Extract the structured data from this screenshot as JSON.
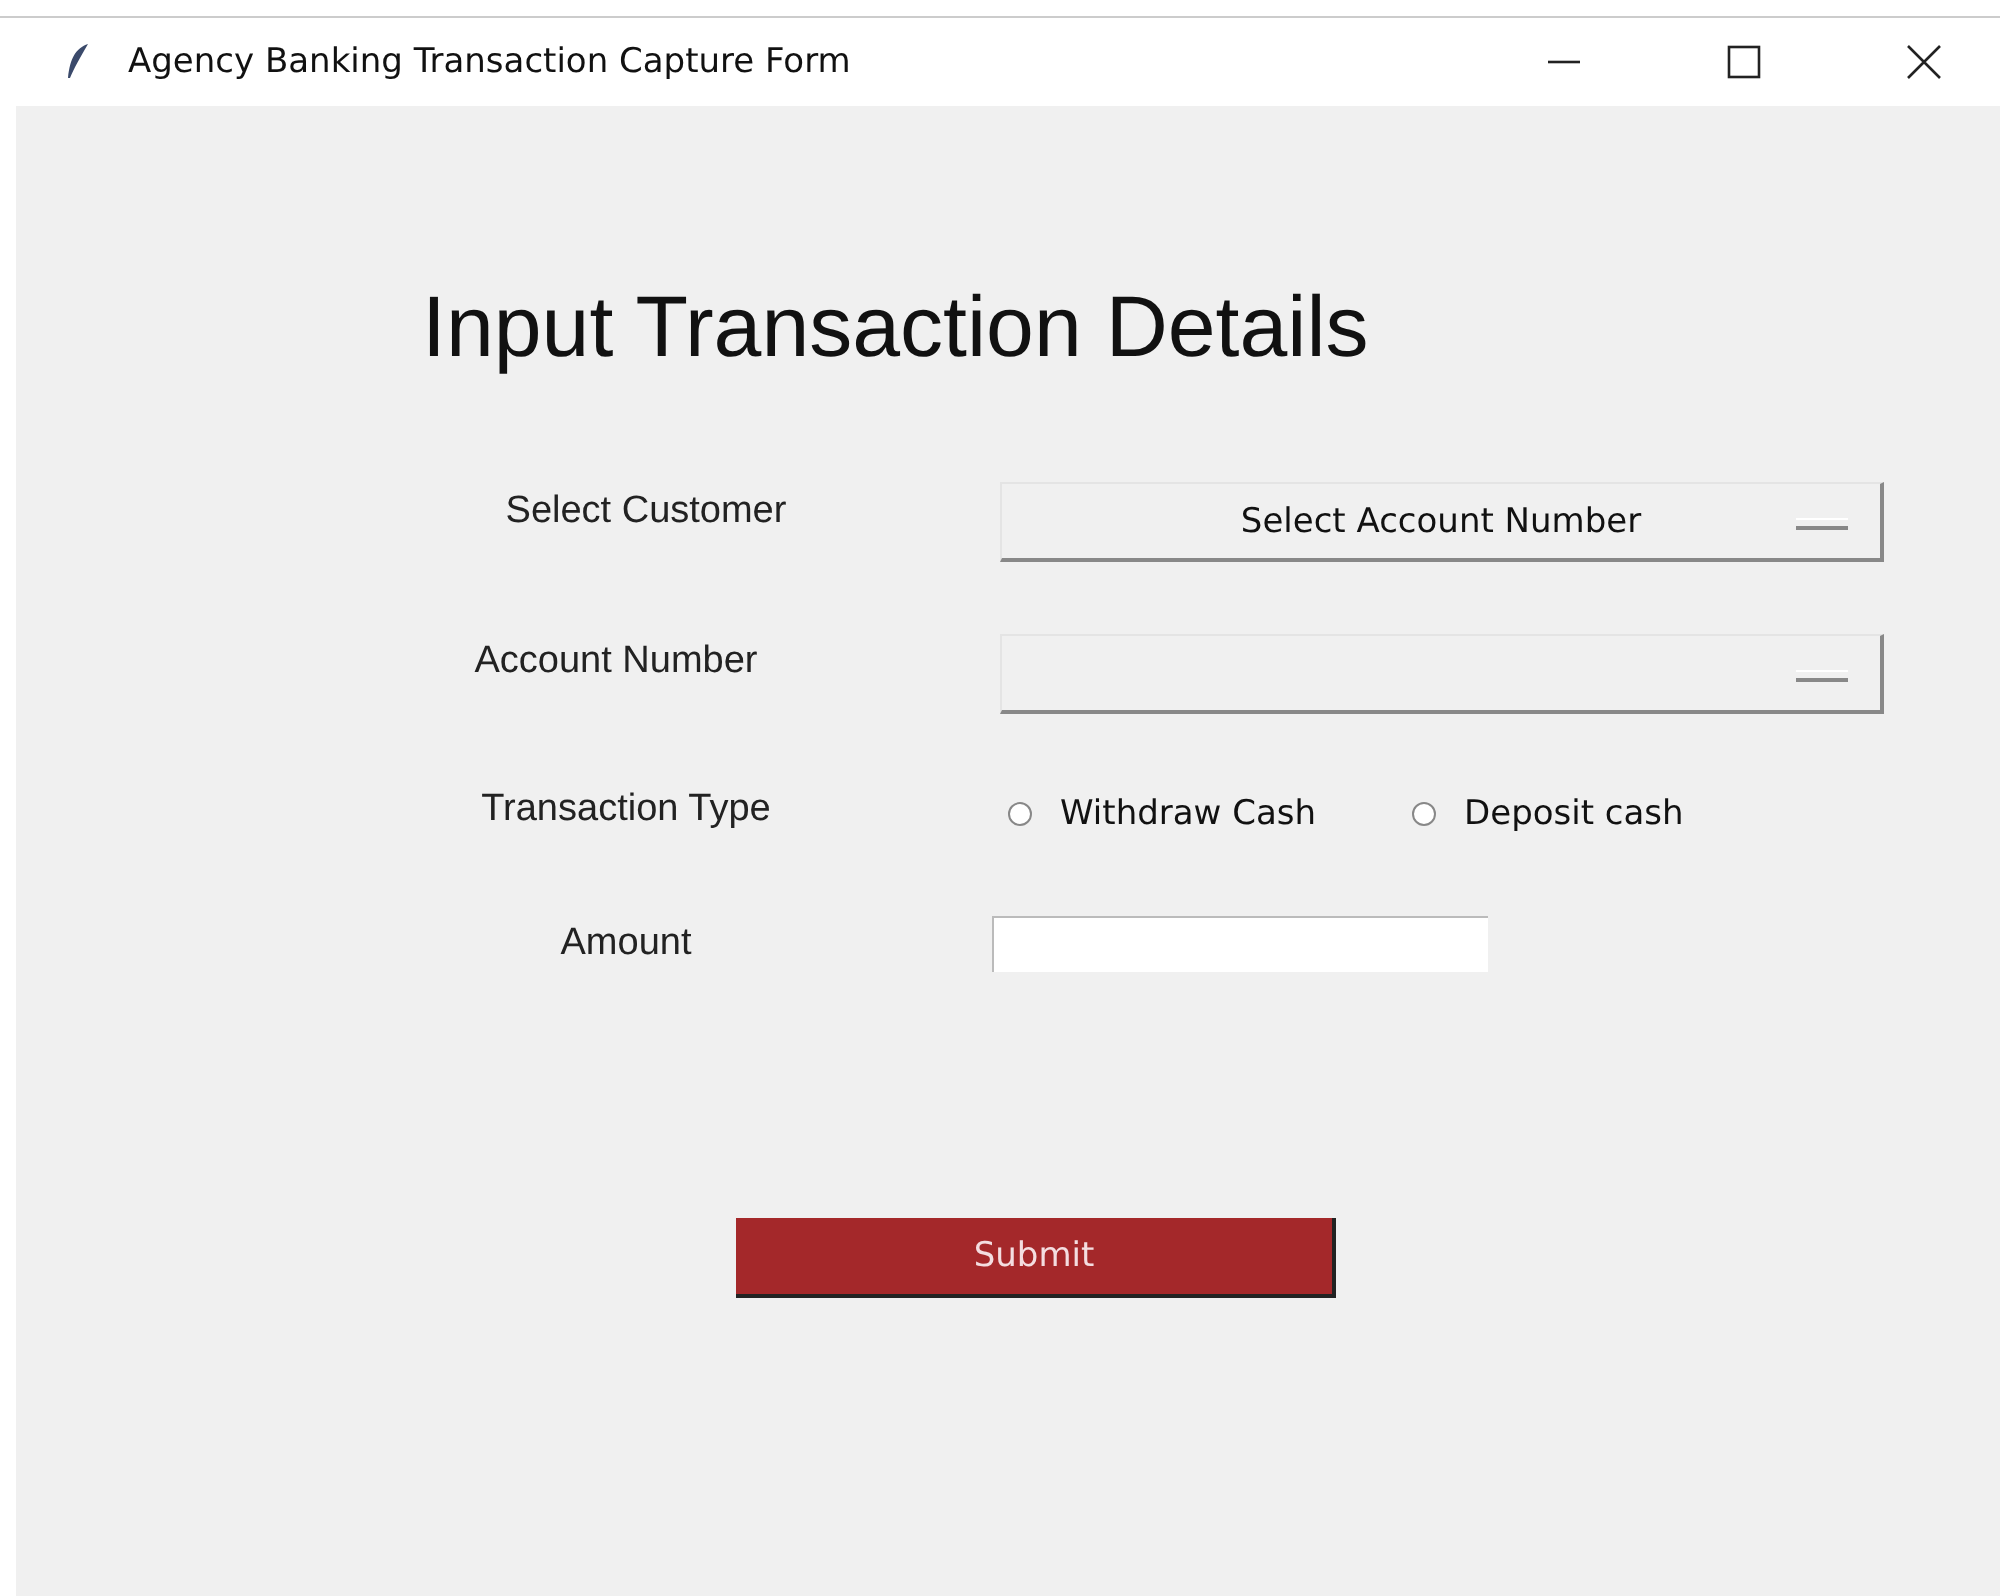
{
  "window": {
    "title": "Agency Banking Transaction Capture Form"
  },
  "heading": "Input Transaction Details",
  "customer": {
    "label": "Select Customer",
    "value": "Select Account Number"
  },
  "account": {
    "label": "Account Number"
  },
  "transaction_type": {
    "label": "Transaction Type",
    "options": [
      {
        "label": "Withdraw Cash",
        "selected": false
      },
      {
        "label": "Deposit cash",
        "selected": false
      }
    ]
  },
  "amount": {
    "label": "Amount"
  },
  "submit": "Submit"
}
